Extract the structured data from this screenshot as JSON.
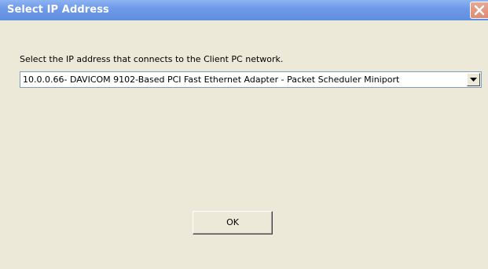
{
  "window": {
    "title": "Select IP Address"
  },
  "dialog": {
    "prompt": "Select the IP address that connects to the Client PC network.",
    "ip_select": {
      "selected_value": "10.0.0.66- DAVICOM 9102-Based PCI Fast Ethernet Adapter - Packet Scheduler Miniport"
    },
    "ok_label": "OK"
  },
  "colors": {
    "titlebar": "#6f9ae8",
    "close_button": "#dd8a72",
    "dialog_background": "#ece9d8",
    "select_border": "#7f9db9"
  },
  "icons": {
    "close": "close-icon",
    "dropdown": "chevron-down-icon"
  }
}
